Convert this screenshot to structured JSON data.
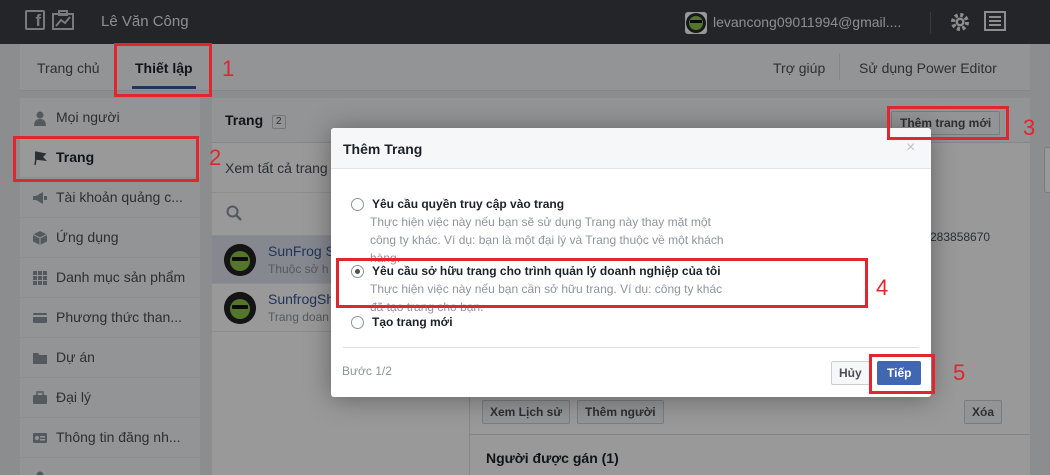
{
  "topbar": {
    "user_name": "Lê Văn Công",
    "email": "levancong09011994@gmail...."
  },
  "nav": {
    "tabs": [
      "Trang chủ",
      "Thiết lập"
    ],
    "right_links": [
      "Trợ giúp",
      "Sử dụng Power Editor"
    ]
  },
  "sidebar": {
    "items": [
      {
        "label": "Mọi người",
        "icon": "person-icon"
      },
      {
        "label": "Trang",
        "icon": "flag-icon"
      },
      {
        "label": "Tài khoản quảng c...",
        "icon": "megaphone-icon"
      },
      {
        "label": "Ứng dụng",
        "icon": "cube-icon"
      },
      {
        "label": "Danh mục sản phẩm",
        "icon": "grid-icon"
      },
      {
        "label": "Phương thức than...",
        "icon": "card-icon"
      },
      {
        "label": "Dự án",
        "icon": "folder-icon"
      },
      {
        "label": "Đại lý",
        "icon": "briefcase-icon"
      },
      {
        "label": "Thông tin đăng nh...",
        "icon": "id-card-icon"
      }
    ]
  },
  "main": {
    "title": "Trang",
    "count": "2",
    "add_page_label": "Thêm trang mới",
    "view_all": "Xem tất cả trang",
    "pages": [
      {
        "name": "SunFrog S",
        "sub": "Thuộc sở h"
      },
      {
        "name": "SunfrogSh",
        "sub": "Trang doan"
      }
    ],
    "detail_id": "283858670",
    "buttons": {
      "history": "Xem Lịch sử",
      "add_people": "Thêm người",
      "delete": "Xóa"
    },
    "assigned_title": "Người được gán",
    "assigned_count": "(1)"
  },
  "dialog": {
    "title": "Thêm Trang",
    "close": "×",
    "options": [
      {
        "title": "Yêu cầu quyền truy cập vào trang",
        "desc": "Thực hiện việc này nếu bạn sẽ sử dụng Trang này thay mặt một công ty khác. Ví dụ: bạn là một đại lý và Trang thuộc về một khách hàng.",
        "selected": false
      },
      {
        "title": "Yêu cầu sở hữu trang cho trình quản lý doanh nghiệp của tôi",
        "desc": "Thực hiện việc này nếu bạn cần sở hữu trang. Ví dụ: công ty khác đã tạo trang cho bạn.",
        "selected": true
      },
      {
        "title": "Tạo trang mới",
        "desc": "",
        "selected": false
      }
    ],
    "step": "Bước 1/2",
    "cancel_label": "Hủy",
    "next_label": "Tiếp"
  },
  "annotations": [
    "1",
    "2",
    "3",
    "4",
    "5"
  ],
  "colors": {
    "topbar": "#3b3e44",
    "brand_blue": "#4267b2",
    "annotation_red": "#e0262e"
  }
}
